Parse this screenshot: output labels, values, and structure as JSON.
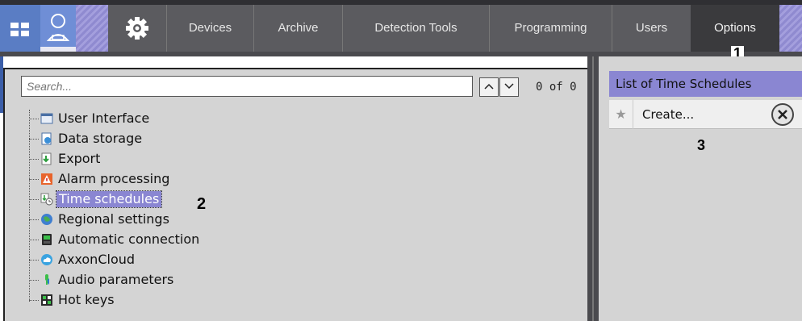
{
  "topbar": {
    "icons": {
      "layouts": "grid-icon",
      "search": "search-person-icon",
      "settings": "gear-icon"
    },
    "tabs": [
      {
        "label": "Devices"
      },
      {
        "label": "Archive"
      },
      {
        "label": "Detection Tools"
      },
      {
        "label": "Programming"
      },
      {
        "label": "Users"
      },
      {
        "label": "Options",
        "active": true
      }
    ]
  },
  "callouts": {
    "one": "1",
    "two": "2",
    "three": "3"
  },
  "search": {
    "placeholder": "Search...",
    "match_count": "0 of 0"
  },
  "tree": {
    "items": [
      {
        "label": "User Interface",
        "icon": "window-icon"
      },
      {
        "label": "Data storage",
        "icon": "storage-icon"
      },
      {
        "label": "Export",
        "icon": "export-icon"
      },
      {
        "label": "Alarm processing",
        "icon": "alarm-icon"
      },
      {
        "label": "Time schedules",
        "icon": "time-schedule-icon",
        "selected": true
      },
      {
        "label": "Regional settings",
        "icon": "globe-icon"
      },
      {
        "label": "Automatic connection",
        "icon": "connection-icon"
      },
      {
        "label": "AxxonCloud",
        "icon": "cloud-icon"
      },
      {
        "label": "Audio parameters",
        "icon": "audio-icon"
      },
      {
        "label": "Hot keys",
        "icon": "keyboard-icon"
      }
    ]
  },
  "schedules_panel": {
    "title": "List of Time Schedules",
    "create_label": "Create..."
  },
  "colors": {
    "accent": "#8a86d2",
    "nav_bg": "#5b5b5f",
    "panel_bg": "#d4d4d4",
    "active_tab": "#3a3a3d"
  }
}
